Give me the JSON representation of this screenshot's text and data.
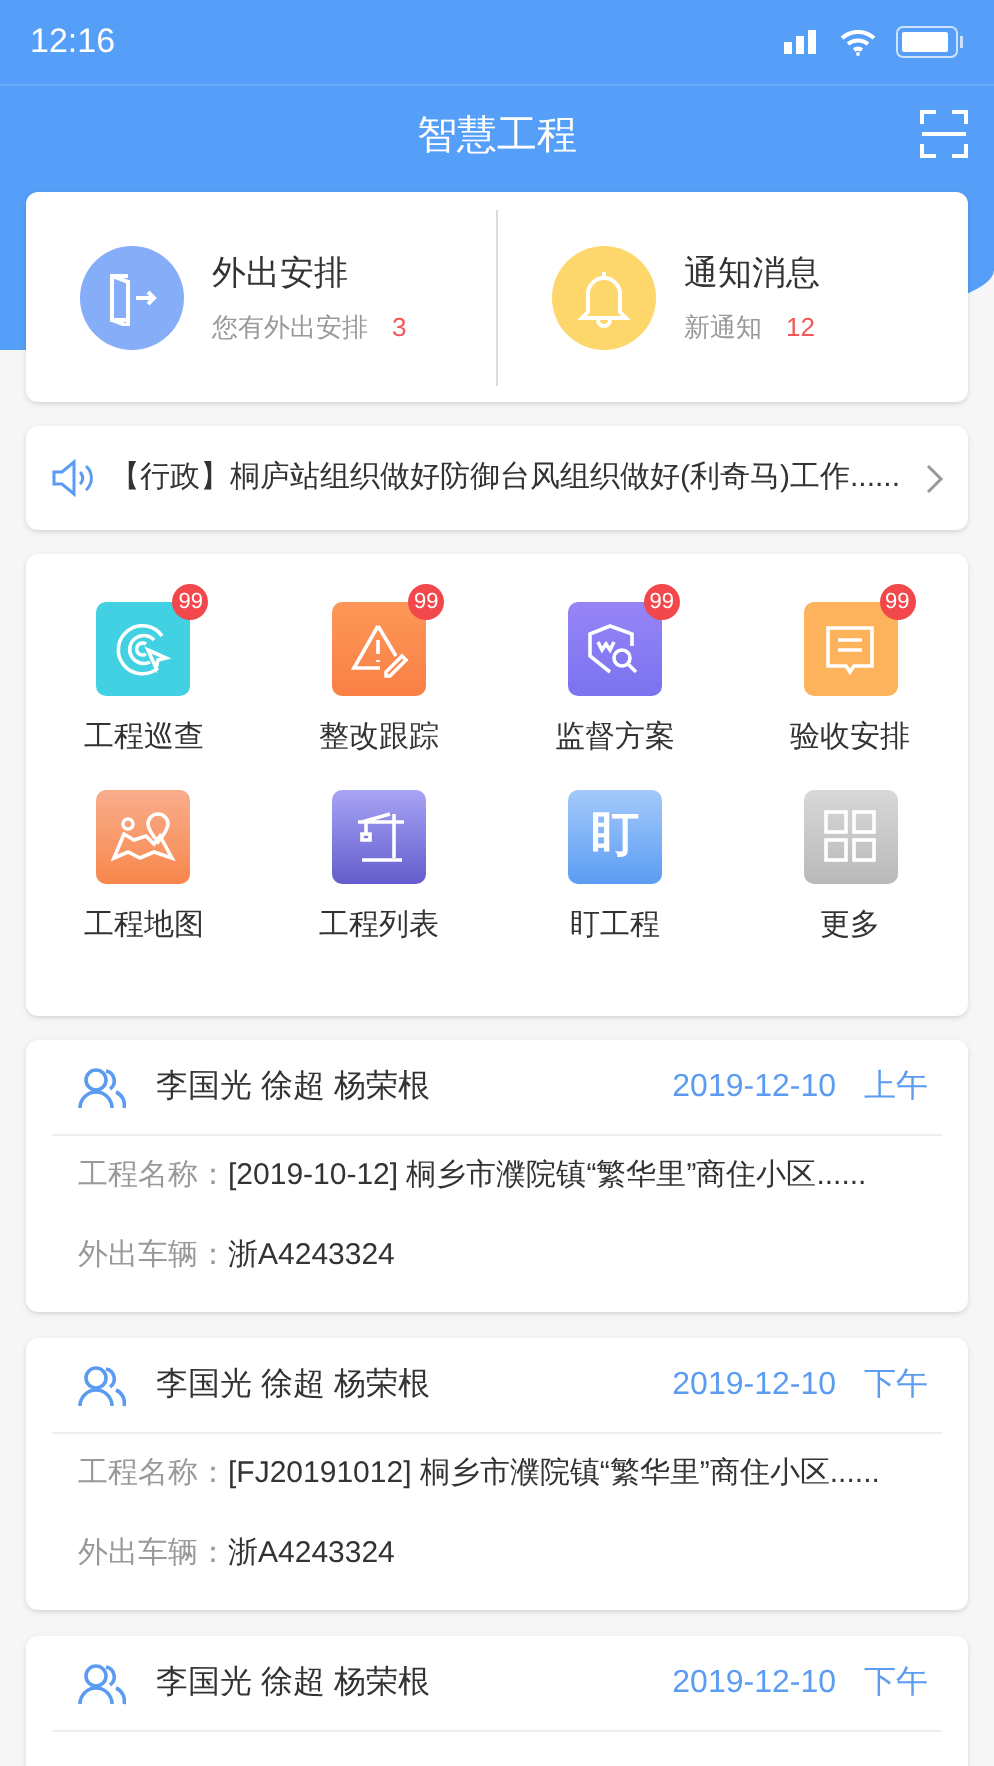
{
  "status_bar": {
    "time": "12:16"
  },
  "header": {
    "title": "智慧工程"
  },
  "summary": [
    {
      "title": "外出安排",
      "subtitle": "您有外出安排",
      "count": "3"
    },
    {
      "title": "通知消息",
      "subtitle": "新通知",
      "count": "12"
    }
  ],
  "notice": {
    "text": "【行政】桐庐站组织做好防御台风组织做好(利奇马)工作......"
  },
  "shortcuts": [
    {
      "label": "工程巡查",
      "badge": "99"
    },
    {
      "label": "整改跟踪",
      "badge": "99"
    },
    {
      "label": "监督方案",
      "badge": "99"
    },
    {
      "label": "验收安排",
      "badge": "99"
    },
    {
      "label": "工程地图"
    },
    {
      "label": "工程列表"
    },
    {
      "label": "盯工程",
      "icon_text": "盯"
    },
    {
      "label": "更多"
    }
  ],
  "records": [
    {
      "people": "李国光 徐超 杨荣根",
      "date": "2019-12-10",
      "period": "上午",
      "fields": [
        {
          "label": "工程名称：",
          "value": "[2019-10-12] 桐乡市濮院镇“繁华里”商住小区......"
        },
        {
          "label": "外出车辆：",
          "value": "浙A4243324"
        }
      ]
    },
    {
      "people": "李国光 徐超 杨荣根",
      "date": "2019-12-10",
      "period": "下午",
      "fields": [
        {
          "label": "工程名称：",
          "value": "[FJ20191012] 桐乡市濮院镇“繁华里”商住小区......"
        },
        {
          "label": "外出车辆：",
          "value": "浙A4243324"
        }
      ]
    },
    {
      "people": "李国光 徐超 杨荣根",
      "date": "2019-12-10",
      "period": "下午"
    }
  ]
}
